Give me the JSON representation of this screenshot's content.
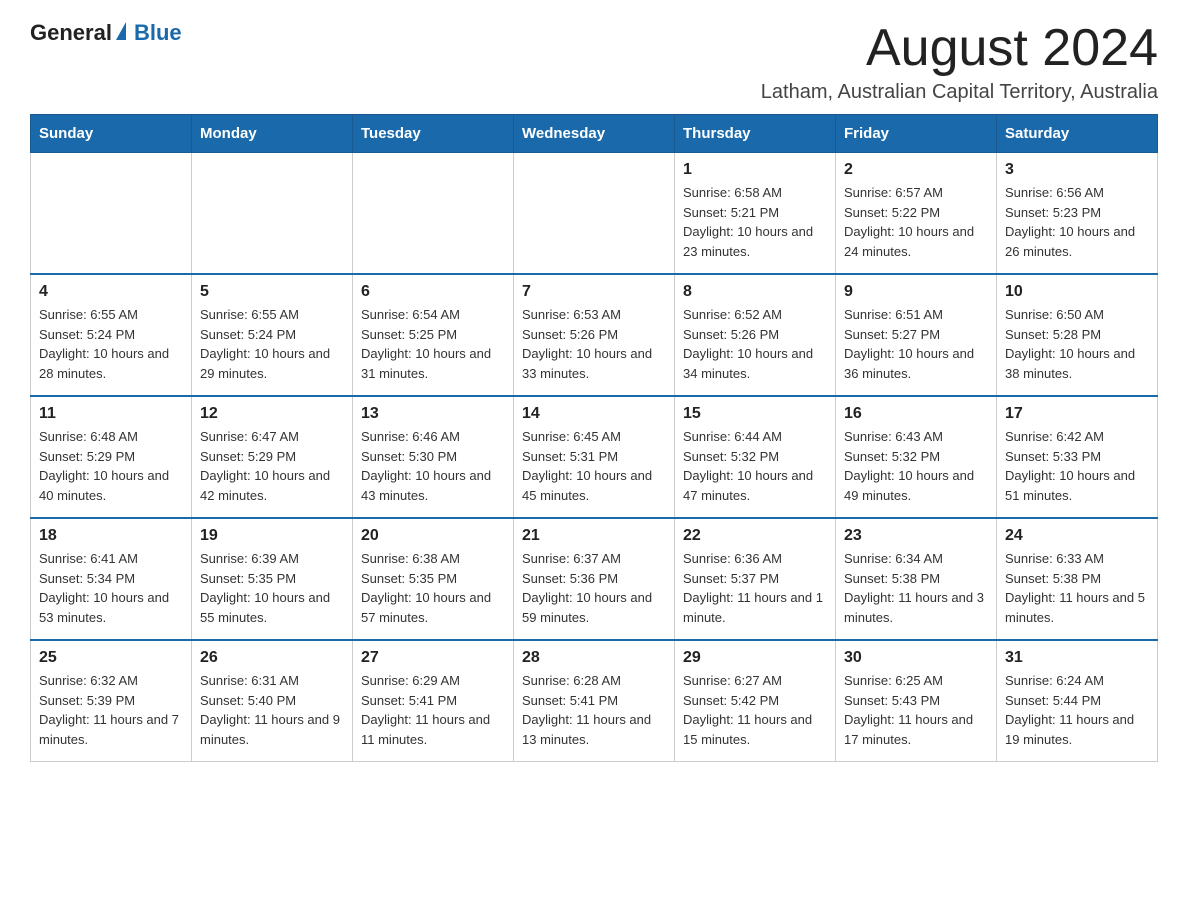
{
  "header": {
    "logo": {
      "text_general": "General",
      "text_blue": "Blue",
      "triangle_alt": "logo triangle"
    },
    "month_title": "August 2024",
    "location": "Latham, Australian Capital Territory, Australia"
  },
  "calendar": {
    "days_of_week": [
      "Sunday",
      "Monday",
      "Tuesday",
      "Wednesday",
      "Thursday",
      "Friday",
      "Saturday"
    ],
    "weeks": [
      [
        {
          "day": "",
          "sunrise": "",
          "sunset": "",
          "daylight": ""
        },
        {
          "day": "",
          "sunrise": "",
          "sunset": "",
          "daylight": ""
        },
        {
          "day": "",
          "sunrise": "",
          "sunset": "",
          "daylight": ""
        },
        {
          "day": "",
          "sunrise": "",
          "sunset": "",
          "daylight": ""
        },
        {
          "day": "1",
          "sunrise": "Sunrise: 6:58 AM",
          "sunset": "Sunset: 5:21 PM",
          "daylight": "Daylight: 10 hours and 23 minutes."
        },
        {
          "day": "2",
          "sunrise": "Sunrise: 6:57 AM",
          "sunset": "Sunset: 5:22 PM",
          "daylight": "Daylight: 10 hours and 24 minutes."
        },
        {
          "day": "3",
          "sunrise": "Sunrise: 6:56 AM",
          "sunset": "Sunset: 5:23 PM",
          "daylight": "Daylight: 10 hours and 26 minutes."
        }
      ],
      [
        {
          "day": "4",
          "sunrise": "Sunrise: 6:55 AM",
          "sunset": "Sunset: 5:24 PM",
          "daylight": "Daylight: 10 hours and 28 minutes."
        },
        {
          "day": "5",
          "sunrise": "Sunrise: 6:55 AM",
          "sunset": "Sunset: 5:24 PM",
          "daylight": "Daylight: 10 hours and 29 minutes."
        },
        {
          "day": "6",
          "sunrise": "Sunrise: 6:54 AM",
          "sunset": "Sunset: 5:25 PM",
          "daylight": "Daylight: 10 hours and 31 minutes."
        },
        {
          "day": "7",
          "sunrise": "Sunrise: 6:53 AM",
          "sunset": "Sunset: 5:26 PM",
          "daylight": "Daylight: 10 hours and 33 minutes."
        },
        {
          "day": "8",
          "sunrise": "Sunrise: 6:52 AM",
          "sunset": "Sunset: 5:26 PM",
          "daylight": "Daylight: 10 hours and 34 minutes."
        },
        {
          "day": "9",
          "sunrise": "Sunrise: 6:51 AM",
          "sunset": "Sunset: 5:27 PM",
          "daylight": "Daylight: 10 hours and 36 minutes."
        },
        {
          "day": "10",
          "sunrise": "Sunrise: 6:50 AM",
          "sunset": "Sunset: 5:28 PM",
          "daylight": "Daylight: 10 hours and 38 minutes."
        }
      ],
      [
        {
          "day": "11",
          "sunrise": "Sunrise: 6:48 AM",
          "sunset": "Sunset: 5:29 PM",
          "daylight": "Daylight: 10 hours and 40 minutes."
        },
        {
          "day": "12",
          "sunrise": "Sunrise: 6:47 AM",
          "sunset": "Sunset: 5:29 PM",
          "daylight": "Daylight: 10 hours and 42 minutes."
        },
        {
          "day": "13",
          "sunrise": "Sunrise: 6:46 AM",
          "sunset": "Sunset: 5:30 PM",
          "daylight": "Daylight: 10 hours and 43 minutes."
        },
        {
          "day": "14",
          "sunrise": "Sunrise: 6:45 AM",
          "sunset": "Sunset: 5:31 PM",
          "daylight": "Daylight: 10 hours and 45 minutes."
        },
        {
          "day": "15",
          "sunrise": "Sunrise: 6:44 AM",
          "sunset": "Sunset: 5:32 PM",
          "daylight": "Daylight: 10 hours and 47 minutes."
        },
        {
          "day": "16",
          "sunrise": "Sunrise: 6:43 AM",
          "sunset": "Sunset: 5:32 PM",
          "daylight": "Daylight: 10 hours and 49 minutes."
        },
        {
          "day": "17",
          "sunrise": "Sunrise: 6:42 AM",
          "sunset": "Sunset: 5:33 PM",
          "daylight": "Daylight: 10 hours and 51 minutes."
        }
      ],
      [
        {
          "day": "18",
          "sunrise": "Sunrise: 6:41 AM",
          "sunset": "Sunset: 5:34 PM",
          "daylight": "Daylight: 10 hours and 53 minutes."
        },
        {
          "day": "19",
          "sunrise": "Sunrise: 6:39 AM",
          "sunset": "Sunset: 5:35 PM",
          "daylight": "Daylight: 10 hours and 55 minutes."
        },
        {
          "day": "20",
          "sunrise": "Sunrise: 6:38 AM",
          "sunset": "Sunset: 5:35 PM",
          "daylight": "Daylight: 10 hours and 57 minutes."
        },
        {
          "day": "21",
          "sunrise": "Sunrise: 6:37 AM",
          "sunset": "Sunset: 5:36 PM",
          "daylight": "Daylight: 10 hours and 59 minutes."
        },
        {
          "day": "22",
          "sunrise": "Sunrise: 6:36 AM",
          "sunset": "Sunset: 5:37 PM",
          "daylight": "Daylight: 11 hours and 1 minute."
        },
        {
          "day": "23",
          "sunrise": "Sunrise: 6:34 AM",
          "sunset": "Sunset: 5:38 PM",
          "daylight": "Daylight: 11 hours and 3 minutes."
        },
        {
          "day": "24",
          "sunrise": "Sunrise: 6:33 AM",
          "sunset": "Sunset: 5:38 PM",
          "daylight": "Daylight: 11 hours and 5 minutes."
        }
      ],
      [
        {
          "day": "25",
          "sunrise": "Sunrise: 6:32 AM",
          "sunset": "Sunset: 5:39 PM",
          "daylight": "Daylight: 11 hours and 7 minutes."
        },
        {
          "day": "26",
          "sunrise": "Sunrise: 6:31 AM",
          "sunset": "Sunset: 5:40 PM",
          "daylight": "Daylight: 11 hours and 9 minutes."
        },
        {
          "day": "27",
          "sunrise": "Sunrise: 6:29 AM",
          "sunset": "Sunset: 5:41 PM",
          "daylight": "Daylight: 11 hours and 11 minutes."
        },
        {
          "day": "28",
          "sunrise": "Sunrise: 6:28 AM",
          "sunset": "Sunset: 5:41 PM",
          "daylight": "Daylight: 11 hours and 13 minutes."
        },
        {
          "day": "29",
          "sunrise": "Sunrise: 6:27 AM",
          "sunset": "Sunset: 5:42 PM",
          "daylight": "Daylight: 11 hours and 15 minutes."
        },
        {
          "day": "30",
          "sunrise": "Sunrise: 6:25 AM",
          "sunset": "Sunset: 5:43 PM",
          "daylight": "Daylight: 11 hours and 17 minutes."
        },
        {
          "day": "31",
          "sunrise": "Sunrise: 6:24 AM",
          "sunset": "Sunset: 5:44 PM",
          "daylight": "Daylight: 11 hours and 19 minutes."
        }
      ]
    ]
  }
}
